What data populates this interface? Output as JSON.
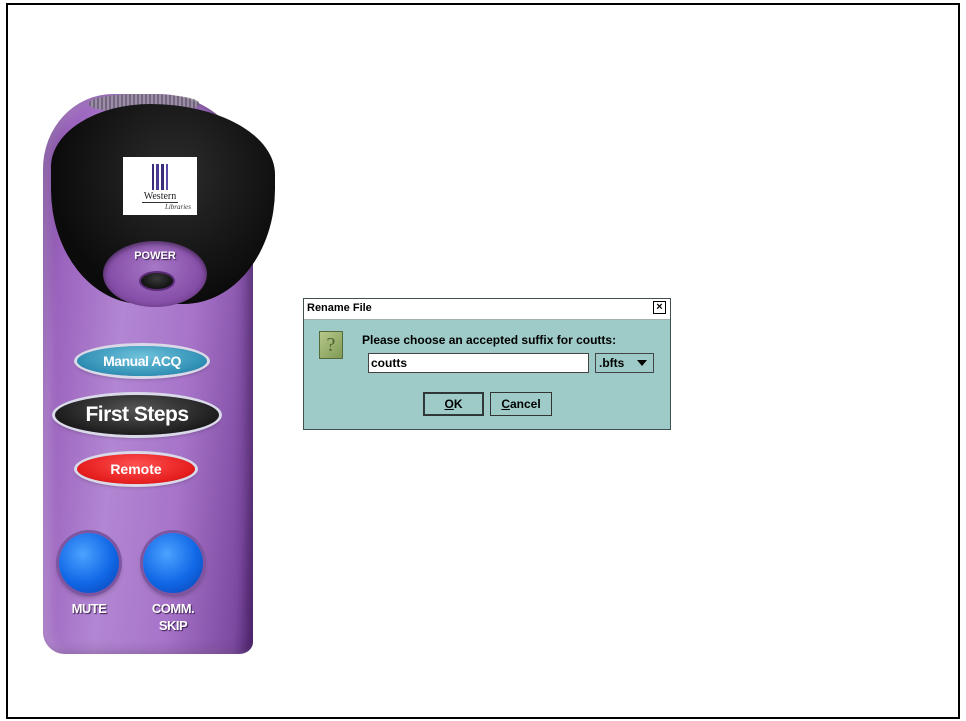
{
  "remote": {
    "logo_line1": "Western",
    "logo_line2": "Libraries",
    "power_label": "POWER",
    "manual_acq_label": "Manual ACQ",
    "first_steps_label": "First Steps",
    "remote_label": "Remote",
    "mute_label": "MUTE",
    "comm_skip_label_line1": "COMM.",
    "comm_skip_label_line2": "SKIP",
    "colors": {
      "body": "#a774c9",
      "manual_acq": "#2f8fb4",
      "first_steps": "#1a1a1a",
      "remote": "#e41c1c",
      "round_buttons": "#1168e6"
    },
    "icons": [
      "speaker-grille-icon",
      "library-logo-icon"
    ]
  },
  "dialog": {
    "title": "Rename File",
    "close_glyph": "×",
    "message": "Please choose an accepted suffix for coutts:",
    "filename_value": "coutts",
    "suffix_selected": ".bfts",
    "ok_label_mnemonic": "O",
    "ok_label_rest": "K",
    "cancel_label_mnemonic": "C",
    "cancel_label_rest": "ancel",
    "icon": "question-icon",
    "question_glyph": "?",
    "background_color": "#9ecbc8"
  }
}
